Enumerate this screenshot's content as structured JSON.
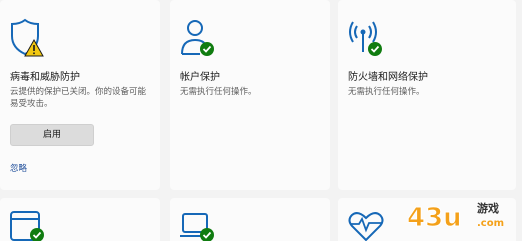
{
  "cards": [
    {
      "icon": "shield-warning-icon",
      "title": "病毒和威胁防护",
      "description": "云提供的保护已关闭。你的设备可能易受攻击。",
      "button_label": "启用",
      "link_label": "忽略"
    },
    {
      "icon": "account-check-icon",
      "title": "帐户保护",
      "description": "无需执行任何操作。"
    },
    {
      "icon": "firewall-check-icon",
      "title": "防火墙和网络保护",
      "description": "无需执行任何操作。"
    },
    {
      "icon": "app-browser-check-icon"
    },
    {
      "icon": "device-security-check-icon"
    },
    {
      "icon": "device-health-heart-icon"
    }
  ],
  "watermark": {
    "brand": "43u",
    "suffix": "游戏",
    "domain": ".com"
  },
  "colors": {
    "icon_blue": "#1668b7",
    "check_green": "#107c10",
    "warning_yellow": "#f2c811",
    "link_blue": "#1f4e9a",
    "watermark_orange": "#f4a11a"
  }
}
